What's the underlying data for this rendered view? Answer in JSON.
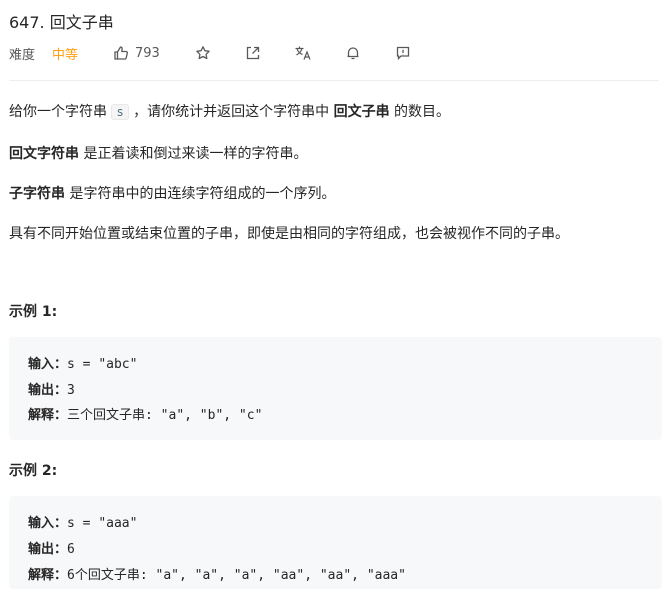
{
  "problem": {
    "title": "647. 回文子串",
    "difficulty_label": "难度",
    "difficulty": "中等",
    "likes": "793"
  },
  "icons": [
    "thumbs-up-icon",
    "star-icon",
    "share-icon",
    "translate-icon",
    "bell-icon",
    "feedback-icon"
  ],
  "colors": {
    "difficulty_medium": "#ffa116",
    "code_bg": "#f7f8fa"
  },
  "desc": {
    "p1_pre": "给你一个字符串 ",
    "p1_code": "s",
    "p1_mid": " ，请你统计并返回这个字符串中 ",
    "p1_bold": "回文子串",
    "p1_post": " 的数目。",
    "p2_bold": "回文字符串",
    "p2_post": " 是正着读和倒过来读一样的字符串。",
    "p3_bold": "子字符串",
    "p3_post": " 是字符串中的由连续字符组成的一个序列。",
    "p4": "具有不同开始位置或结束位置的子串，即使是由相同的字符组成，也会被视作不同的子串。"
  },
  "examples": [
    {
      "title": "示例 1:",
      "input_label": "输入：",
      "input": "s = \"abc\"",
      "output_label": "输出：",
      "output": "3",
      "explain_label": "解释：",
      "explain": "三个回文子串: \"a\", \"b\", \"c\""
    },
    {
      "title": "示例 2:",
      "input_label": "输入：",
      "input": "s = \"aaa\"",
      "output_label": "输出：",
      "output": "6",
      "explain_label": "解释：",
      "explain": "6个回文子串: \"a\", \"a\", \"a\", \"aa\", \"aa\", \"aaa\""
    }
  ]
}
